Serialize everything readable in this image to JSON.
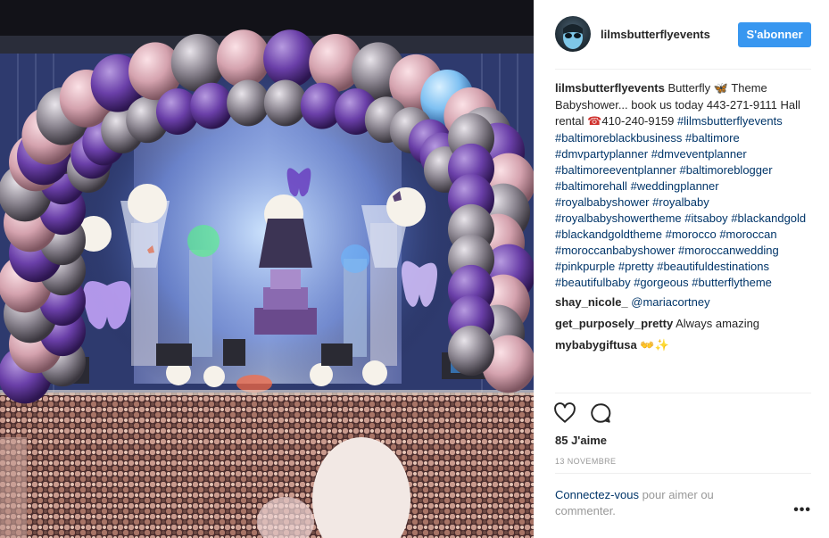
{
  "post": {
    "image_alt": "",
    "author": "lilmsbutterflyevents",
    "follow_label": "S'abonner",
    "caption": {
      "username": "lilmsbutterflyevents",
      "text_part1": "Butterfly ",
      "butterfly_emoji": "🦋",
      "text_part2": " Theme Babyshower... book us today 443-271-9111 Hall rental ",
      "phone_emoji": "☎",
      "text_part3": "410-240-9159",
      "hashtags": [
        "#lilmsbutterflyevents",
        "#baltimoreblackbusiness",
        "#baltimore",
        "#dmvpartyplanner",
        "#dmveventplanner",
        "#baltimoreeventplanner",
        "#baltimoreblogger",
        "#baltimorehall",
        "#weddingplanner",
        "#royalbabyshower",
        "#royalbaby",
        "#royalbabyshowertheme",
        "#itsaboy",
        "#blackandgold",
        "#blackandgoldtheme",
        "#morocco",
        "#moroccan",
        "#moroccanbabyshower",
        "#moroccanwedding",
        "#pinkpurple",
        "#pretty",
        "#beautifuldestinations",
        "#beautifulbaby",
        "#gorgeous",
        "#butterflytheme"
      ]
    },
    "comments": [
      {
        "username": "shay_nicole_",
        "mention": "@mariacortney",
        "text": ""
      },
      {
        "username": "get_purposely_pretty",
        "mention": "",
        "text": "Always amazing"
      },
      {
        "username": "mybabygiftusa",
        "mention": "",
        "text": "",
        "emoji": "👐✨"
      }
    ],
    "likes": "85 J'aime",
    "date": "13 novembre",
    "login_prompt": {
      "link": "Connectez-vous",
      "rest": " pour aimer ou commenter."
    },
    "icons": {
      "like": "heart-icon",
      "comment": "comment-bubble-icon",
      "more": "more-options-icon"
    },
    "colors": {
      "follow_button": "#3897f0",
      "link": "#003569",
      "muted": "#999999",
      "divider": "#efefef"
    }
  }
}
